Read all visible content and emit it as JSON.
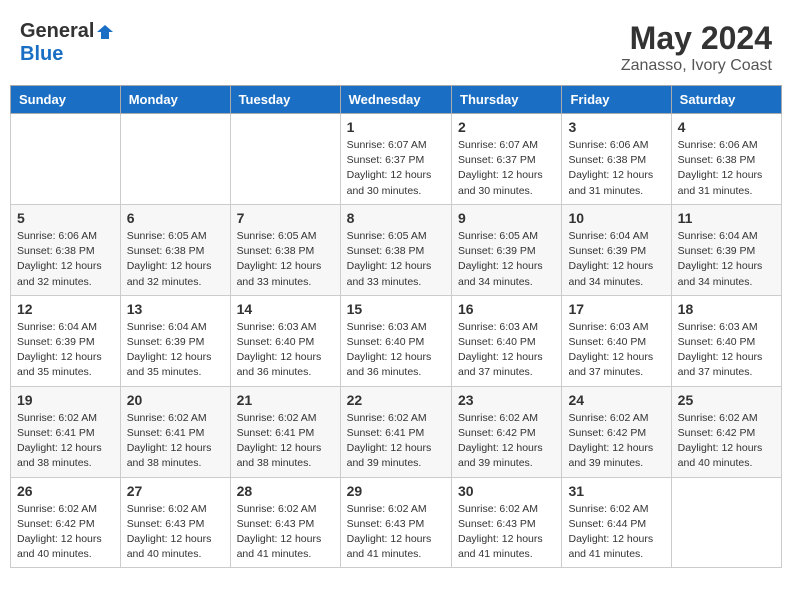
{
  "header": {
    "logo_general": "General",
    "logo_blue": "Blue",
    "title": "May 2024",
    "subtitle": "Zanasso, Ivory Coast"
  },
  "days_of_week": [
    "Sunday",
    "Monday",
    "Tuesday",
    "Wednesday",
    "Thursday",
    "Friday",
    "Saturday"
  ],
  "weeks": [
    [
      {
        "day": "",
        "info": ""
      },
      {
        "day": "",
        "info": ""
      },
      {
        "day": "",
        "info": ""
      },
      {
        "day": "1",
        "info": "Sunrise: 6:07 AM\nSunset: 6:37 PM\nDaylight: 12 hours\nand 30 minutes."
      },
      {
        "day": "2",
        "info": "Sunrise: 6:07 AM\nSunset: 6:37 PM\nDaylight: 12 hours\nand 30 minutes."
      },
      {
        "day": "3",
        "info": "Sunrise: 6:06 AM\nSunset: 6:38 PM\nDaylight: 12 hours\nand 31 minutes."
      },
      {
        "day": "4",
        "info": "Sunrise: 6:06 AM\nSunset: 6:38 PM\nDaylight: 12 hours\nand 31 minutes."
      }
    ],
    [
      {
        "day": "5",
        "info": "Sunrise: 6:06 AM\nSunset: 6:38 PM\nDaylight: 12 hours\nand 32 minutes."
      },
      {
        "day": "6",
        "info": "Sunrise: 6:05 AM\nSunset: 6:38 PM\nDaylight: 12 hours\nand 32 minutes."
      },
      {
        "day": "7",
        "info": "Sunrise: 6:05 AM\nSunset: 6:38 PM\nDaylight: 12 hours\nand 33 minutes."
      },
      {
        "day": "8",
        "info": "Sunrise: 6:05 AM\nSunset: 6:38 PM\nDaylight: 12 hours\nand 33 minutes."
      },
      {
        "day": "9",
        "info": "Sunrise: 6:05 AM\nSunset: 6:39 PM\nDaylight: 12 hours\nand 34 minutes."
      },
      {
        "day": "10",
        "info": "Sunrise: 6:04 AM\nSunset: 6:39 PM\nDaylight: 12 hours\nand 34 minutes."
      },
      {
        "day": "11",
        "info": "Sunrise: 6:04 AM\nSunset: 6:39 PM\nDaylight: 12 hours\nand 34 minutes."
      }
    ],
    [
      {
        "day": "12",
        "info": "Sunrise: 6:04 AM\nSunset: 6:39 PM\nDaylight: 12 hours\nand 35 minutes."
      },
      {
        "day": "13",
        "info": "Sunrise: 6:04 AM\nSunset: 6:39 PM\nDaylight: 12 hours\nand 35 minutes."
      },
      {
        "day": "14",
        "info": "Sunrise: 6:03 AM\nSunset: 6:40 PM\nDaylight: 12 hours\nand 36 minutes."
      },
      {
        "day": "15",
        "info": "Sunrise: 6:03 AM\nSunset: 6:40 PM\nDaylight: 12 hours\nand 36 minutes."
      },
      {
        "day": "16",
        "info": "Sunrise: 6:03 AM\nSunset: 6:40 PM\nDaylight: 12 hours\nand 37 minutes."
      },
      {
        "day": "17",
        "info": "Sunrise: 6:03 AM\nSunset: 6:40 PM\nDaylight: 12 hours\nand 37 minutes."
      },
      {
        "day": "18",
        "info": "Sunrise: 6:03 AM\nSunset: 6:40 PM\nDaylight: 12 hours\nand 37 minutes."
      }
    ],
    [
      {
        "day": "19",
        "info": "Sunrise: 6:02 AM\nSunset: 6:41 PM\nDaylight: 12 hours\nand 38 minutes."
      },
      {
        "day": "20",
        "info": "Sunrise: 6:02 AM\nSunset: 6:41 PM\nDaylight: 12 hours\nand 38 minutes."
      },
      {
        "day": "21",
        "info": "Sunrise: 6:02 AM\nSunset: 6:41 PM\nDaylight: 12 hours\nand 38 minutes."
      },
      {
        "day": "22",
        "info": "Sunrise: 6:02 AM\nSunset: 6:41 PM\nDaylight: 12 hours\nand 39 minutes."
      },
      {
        "day": "23",
        "info": "Sunrise: 6:02 AM\nSunset: 6:42 PM\nDaylight: 12 hours\nand 39 minutes."
      },
      {
        "day": "24",
        "info": "Sunrise: 6:02 AM\nSunset: 6:42 PM\nDaylight: 12 hours\nand 39 minutes."
      },
      {
        "day": "25",
        "info": "Sunrise: 6:02 AM\nSunset: 6:42 PM\nDaylight: 12 hours\nand 40 minutes."
      }
    ],
    [
      {
        "day": "26",
        "info": "Sunrise: 6:02 AM\nSunset: 6:42 PM\nDaylight: 12 hours\nand 40 minutes."
      },
      {
        "day": "27",
        "info": "Sunrise: 6:02 AM\nSunset: 6:43 PM\nDaylight: 12 hours\nand 40 minutes."
      },
      {
        "day": "28",
        "info": "Sunrise: 6:02 AM\nSunset: 6:43 PM\nDaylight: 12 hours\nand 41 minutes."
      },
      {
        "day": "29",
        "info": "Sunrise: 6:02 AM\nSunset: 6:43 PM\nDaylight: 12 hours\nand 41 minutes."
      },
      {
        "day": "30",
        "info": "Sunrise: 6:02 AM\nSunset: 6:43 PM\nDaylight: 12 hours\nand 41 minutes."
      },
      {
        "day": "31",
        "info": "Sunrise: 6:02 AM\nSunset: 6:44 PM\nDaylight: 12 hours\nand 41 minutes."
      },
      {
        "day": "",
        "info": ""
      }
    ]
  ]
}
